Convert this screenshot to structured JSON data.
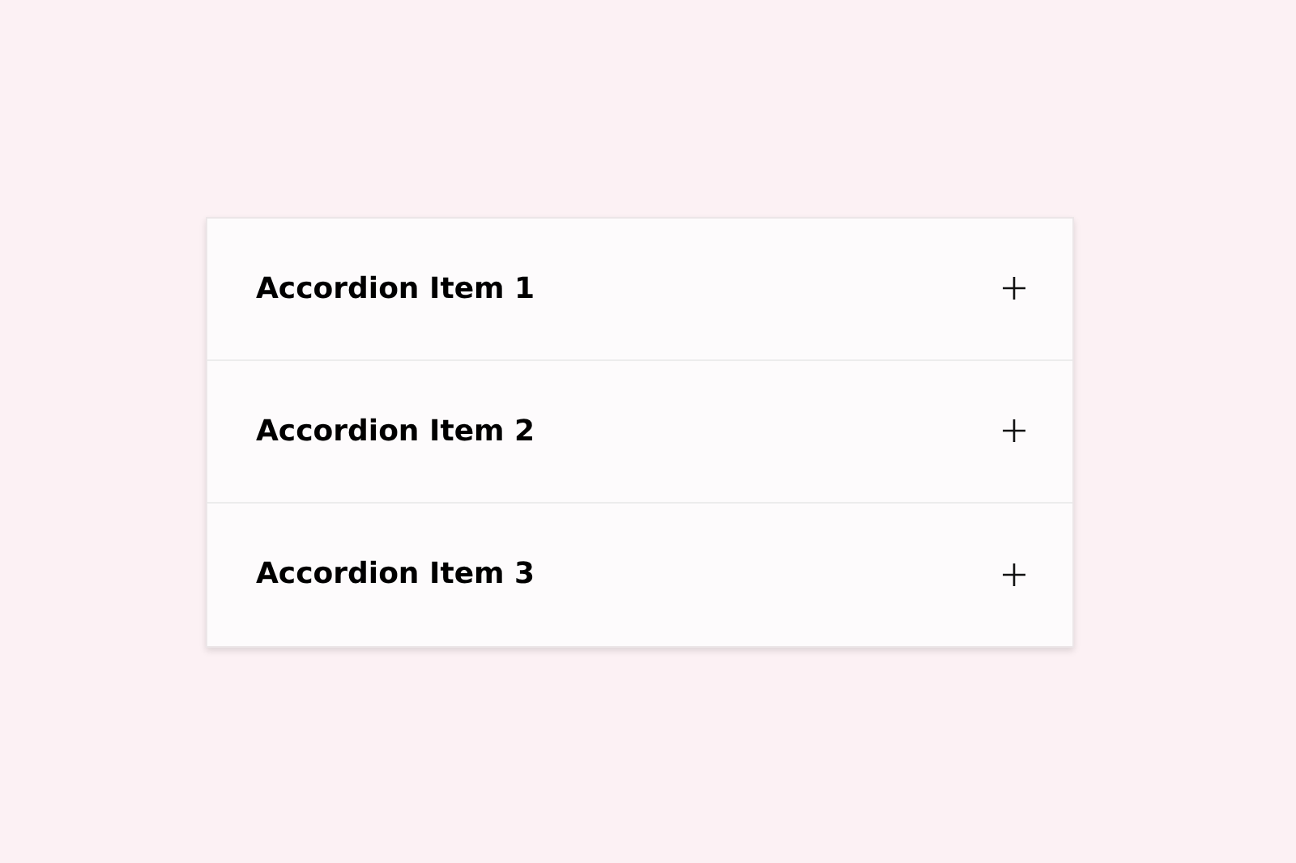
{
  "accordion": {
    "items": [
      {
        "title": "Accordion Item 1",
        "expanded": false
      },
      {
        "title": "Accordion Item 2",
        "expanded": false
      },
      {
        "title": "Accordion Item 3",
        "expanded": false
      }
    ]
  }
}
